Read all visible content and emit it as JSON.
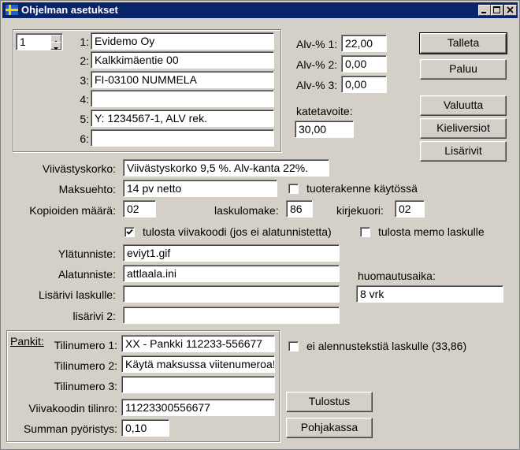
{
  "window": {
    "title": "Ohjelman asetukset"
  },
  "company": {
    "spinner_value": "1",
    "lines": [
      {
        "num": "1:",
        "value": "Evidemo Oy"
      },
      {
        "num": "2:",
        "value": "Kalkkimäentie 00"
      },
      {
        "num": "3:",
        "value": "FI-03100 NUMMELA"
      },
      {
        "num": "4:",
        "value": ""
      },
      {
        "num": "5:",
        "value": "Y: 1234567-1,  ALV rek."
      },
      {
        "num": "6:",
        "value": ""
      }
    ]
  },
  "vat": [
    {
      "label": "Alv-% 1:",
      "value": "22,00"
    },
    {
      "label": "Alv-% 2:",
      "value": "0,00"
    },
    {
      "label": "Alv-% 3:",
      "value": "0,00"
    }
  ],
  "margin_target": {
    "label": "katetavoite:",
    "value": "30,00"
  },
  "buttons": {
    "save": "Talleta",
    "back": "Paluu",
    "currency": "Valuutta",
    "languages": "Kieliversiot",
    "extra_lines": "Lisärivit",
    "print": "Tulostus",
    "template": "Pohjakassa"
  },
  "invoice": {
    "late_interest": {
      "label": "Viivästyskorko:",
      "value": "Viivästyskorko 9,5 %.  Alv-kanta 22%."
    },
    "payment_term": {
      "label": "Maksuehto:",
      "value": "14 pv netto"
    },
    "product_structure": {
      "label": "tuoterakenne käytössä",
      "checked": false
    },
    "copies": {
      "label": "Kopioiden määrä:",
      "value": "02"
    },
    "invoice_form": {
      "label": "laskulomake:",
      "value": "86"
    },
    "envelope": {
      "label": "kirjekuori:",
      "value": "02"
    },
    "print_barcode": {
      "label": "tulosta viivakoodi (jos ei alatunnistetta)",
      "checked": true
    },
    "print_memo": {
      "label": "tulosta memo laskulle",
      "checked": false
    },
    "header": {
      "label": "Ylätunniste:",
      "value": "eviyt1.gif"
    },
    "footer": {
      "label": "Alatunniste:",
      "value": "attlaala.ini"
    },
    "extra_line_invoice": {
      "label": "Lisärivi laskulle:",
      "value": ""
    },
    "extra_line_2": {
      "label": "lisärivi 2:",
      "value": ""
    },
    "notice_time": {
      "label": "huomautusaika:",
      "value": "8 vrk"
    }
  },
  "banks": {
    "group_label": "Pankit:",
    "accounts": [
      {
        "label": "Tilinumero 1:",
        "value": "XX - Pankki 112233-556677"
      },
      {
        "label": "Tilinumero 2:",
        "value": "Käytä maksussa viitenumeroa!"
      },
      {
        "label": "Tilinumero 3:",
        "value": ""
      }
    ],
    "barcode_account": {
      "label": "Viivakoodin tilinro:",
      "value": "11223300556677"
    },
    "rounding": {
      "label": "Summan pyöristys:",
      "value": "0,10"
    },
    "no_discount_text": {
      "label": "ei alennustekstiä laskulle (33,86)",
      "checked": false
    }
  },
  "colors": {
    "titlebar": "#0a246a",
    "face": "#d4d0c8"
  }
}
